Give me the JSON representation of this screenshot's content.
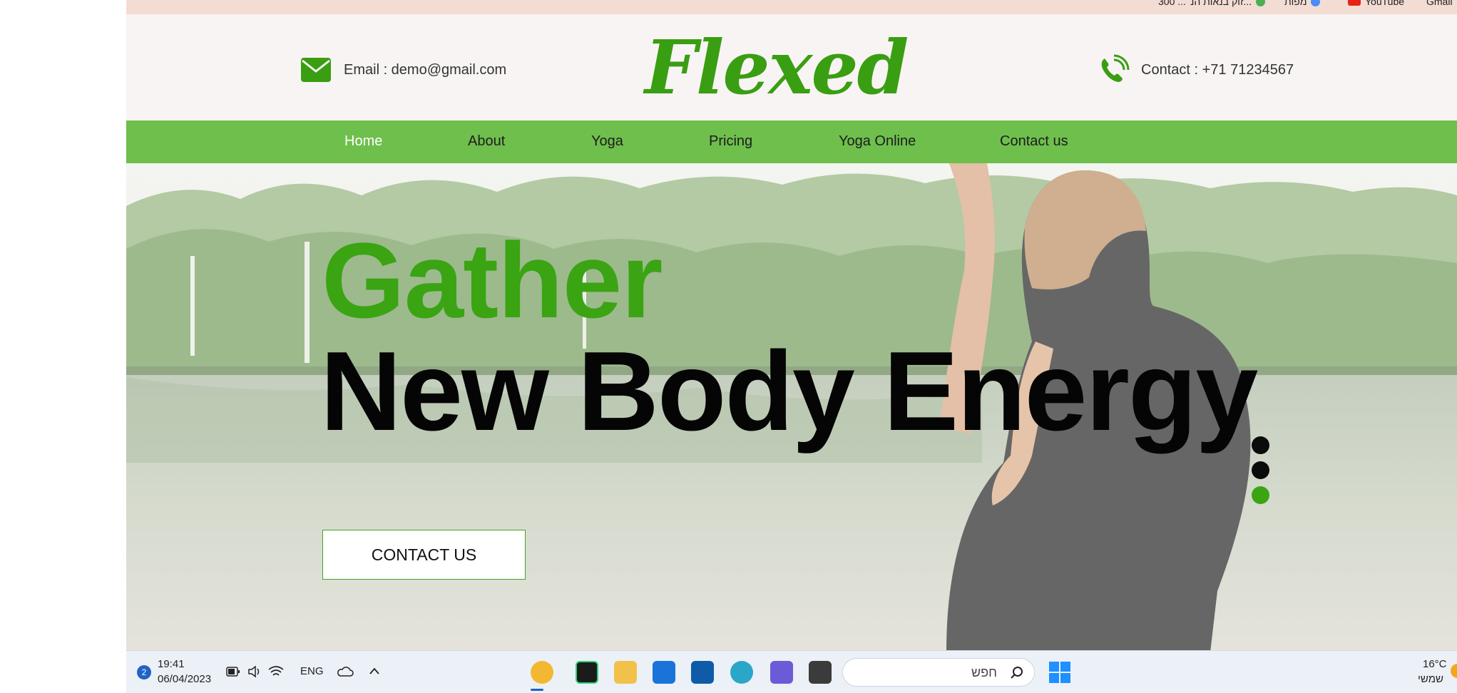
{
  "bookmarks": {
    "items": [
      "Gmail",
      "YouTube",
      "מפות",
      "זוק בנאות הנ... ",
      "300 ..."
    ]
  },
  "header": {
    "email_text": "Email : demo@gmail.com",
    "logo_text": "Flexed",
    "contact_text": "Contact : +71 71234567"
  },
  "nav": {
    "items": [
      "Home",
      "About",
      "Yoga",
      "Pricing",
      "Yoga Online",
      "Contact us"
    ],
    "active": "Home"
  },
  "hero": {
    "line1": "Gather",
    "line2": "New Body Energy",
    "cta_label": "CONTACT US",
    "slider_count": 3,
    "slider_active_index": 2
  },
  "taskbar": {
    "notification_count": "2",
    "time": "19:41",
    "date": "06/04/2023",
    "language": "ENG",
    "search_placeholder": "חפש",
    "weather_temp": "16°C",
    "weather_day": "שמשי"
  },
  "colors": {
    "brand_green": "#3aa413",
    "nav_green": "#6fbf4d",
    "header_bg": "#f8f4f4",
    "bookmarks_bg": "#f3dcd3"
  }
}
